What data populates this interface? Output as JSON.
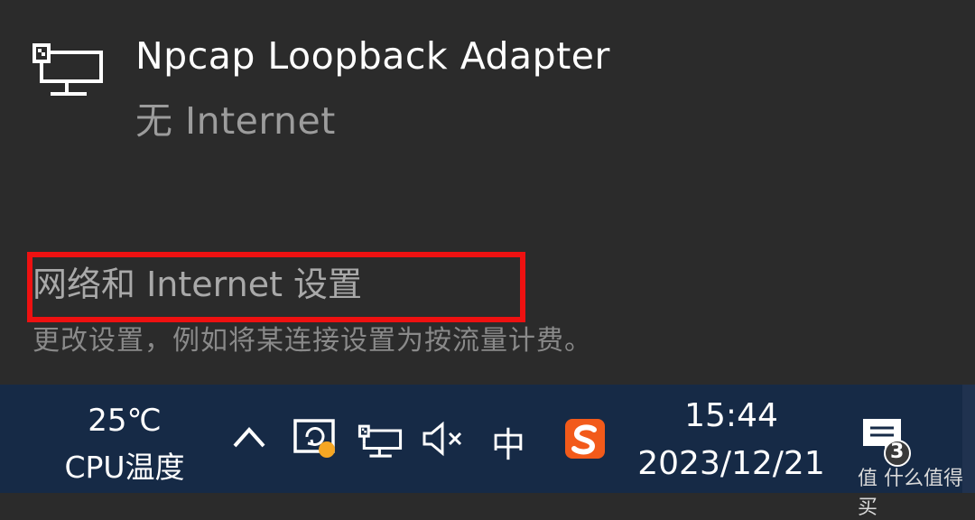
{
  "network": {
    "adapter_name": "Npcap Loopback Adapter",
    "status": "无 Internet",
    "icon": "ethernet-monitor-icon"
  },
  "settings": {
    "link_label": "网络和 Internet 设置",
    "description": "更改设置，例如将某连接设置为按流量计费。"
  },
  "taskbar": {
    "cpu_temp_value": "25℃",
    "cpu_temp_label": "CPU温度",
    "tray_icons": [
      "chevron-up-icon",
      "windows-security-icon",
      "network-icon",
      "volume-muted-icon",
      "ime-mode",
      "sogou-input-icon"
    ],
    "ime_mode": "中",
    "time": "15:44",
    "date": "2023/12/21",
    "notification_count": "3",
    "watermark": "值 什么值得买"
  },
  "colors": {
    "flyout_bg": "#2b2b2b",
    "taskbar_bg": "#162a46",
    "highlight": "#ee1111",
    "sogou_orange": "#f25a1a",
    "security_badge": "#f5a623"
  }
}
